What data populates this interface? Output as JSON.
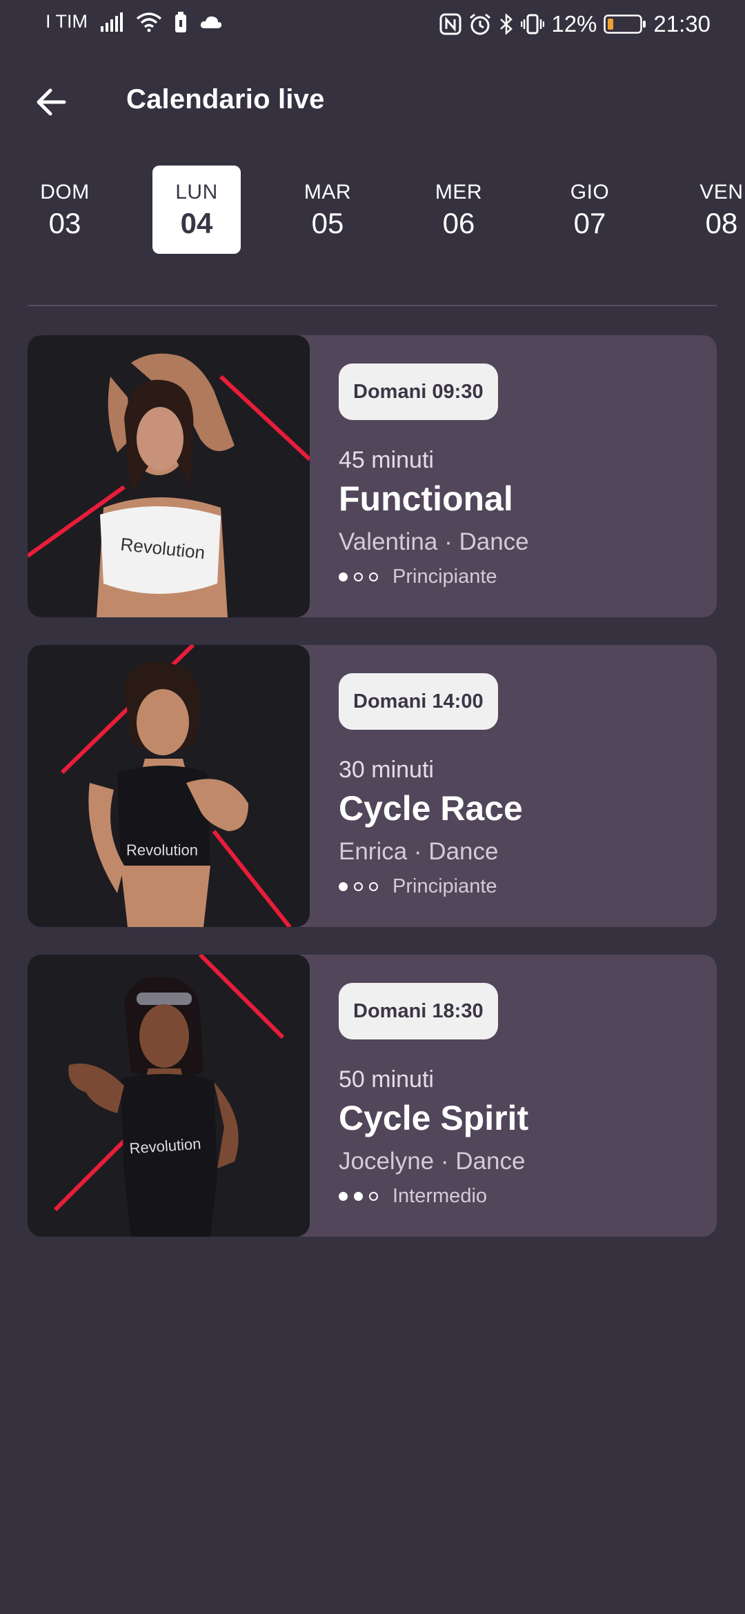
{
  "status_bar": {
    "carrier": "I TIM",
    "battery_percent": "12%",
    "time": "21:30",
    "icons": [
      "signal-icon",
      "wifi-icon",
      "battery-saver-icon",
      "cloud-icon",
      "nfc-icon",
      "alarm-icon",
      "bluetooth-icon",
      "vibrate-icon",
      "battery-icon"
    ]
  },
  "header": {
    "title": "Calendario live",
    "back_icon": "arrow-left-icon"
  },
  "days": [
    {
      "name": "DOM",
      "num": "03",
      "selected": false
    },
    {
      "name": "LUN",
      "num": "04",
      "selected": true
    },
    {
      "name": "MAR",
      "num": "05",
      "selected": false
    },
    {
      "name": "MER",
      "num": "06",
      "selected": false
    },
    {
      "name": "GIO",
      "num": "07",
      "selected": false
    },
    {
      "name": "VEN",
      "num": "08",
      "selected": false
    }
  ],
  "classes": [
    {
      "time": "Domani 09:30",
      "duration": "45 minuti",
      "name": "Functional",
      "meta": "Valentina · Dance",
      "level": "Principiante",
      "level_value": 1,
      "level_max": 3
    },
    {
      "time": "Domani 14:00",
      "duration": "30 minuti",
      "name": "Cycle Race",
      "meta": "Enrica · Dance",
      "level": "Principiante",
      "level_value": 1,
      "level_max": 3
    },
    {
      "time": "Domani 18:30",
      "duration": "50 minuti",
      "name": "Cycle Spirit",
      "meta": "Jocelyne · Dance",
      "level": "Intermedio",
      "level_value": 2,
      "level_max": 3
    }
  ],
  "colors": {
    "background": "#35313f",
    "card": "#51465a",
    "accent_red": "#e0102a",
    "badge": "#f1f0f1"
  }
}
